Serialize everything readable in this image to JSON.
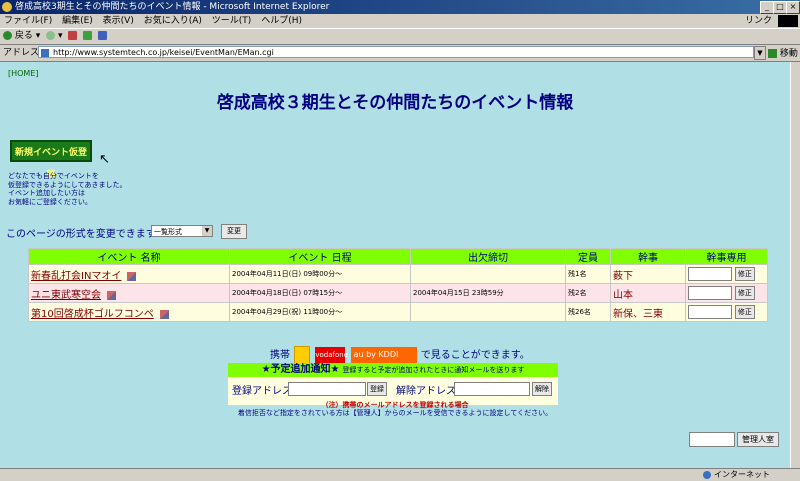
{
  "window": {
    "title": "啓成高校3期生とその仲間たちのイベント情報 - Microsoft Internet Explorer"
  },
  "menu": {
    "items": [
      "ファイル(F)",
      "編集(E)",
      "表示(V)",
      "お気に入り(A)",
      "ツール(T)",
      "ヘルプ(H)"
    ],
    "links_label": "リンク"
  },
  "toolbar": {
    "back_label": "戻る"
  },
  "address": {
    "label": "アドレス(D)",
    "url": "http://www.systemtech.co.jp/keisei/EventMan/EMan.cgi",
    "go_label": "移動"
  },
  "page": {
    "home_link": "[HOME]",
    "title": "啓成高校３期生とその仲間たちのイベント情報",
    "new_event_button": "新規イベント仮登録",
    "notice_text": "どなたでも自分でイベントを\n仮登録できるようにしてあきました。\nイベント追加したい方は\nお気軽にご登録ください。",
    "format_label": "このページの形式を変更できます",
    "format_selected": "一覧形式",
    "change_button": "変更"
  },
  "table": {
    "headers": [
      "イベント 名称",
      "イベント 日程",
      "出欠締切",
      "定員",
      "幹事",
      "幹事専用"
    ],
    "rows": [
      {
        "name": "新春乱打会INマオイ",
        "date": "2004年04月11日(日) 09時00分～",
        "deadline": "",
        "capacity": "残1名",
        "organizer": "薮下",
        "edit": "修正"
      },
      {
        "name": "ユニ東武寒空会",
        "date": "2004年04月18日(日) 07時15分～",
        "deadline": "2004年04月15日 23時59分",
        "capacity": "残2名",
        "organizer": "山本",
        "edit": "修正"
      },
      {
        "name": "第10回啓成杯ゴルフコンペ",
        "date": "2004年04月29日(祝) 11時00分～",
        "deadline": "",
        "capacity": "残26名",
        "organizer": "新保、三東",
        "edit": "修正"
      }
    ]
  },
  "mobile": {
    "prefix": "携帯",
    "suffix": "で見ることができます。",
    "carrier2": "vodafone",
    "carrier3": "au by KDDI"
  },
  "notify": {
    "title": "★予定追加通知★",
    "subtitle": "登録すると予定が追加されたときに通知メールを送ります",
    "register_label": "登録アドレス:",
    "register_button": "登録",
    "unregister_label": "解除アドレス:",
    "unregister_button": "解除",
    "note_warning": "（注）携帯のメールアドレスを登録される場合",
    "note_detail": "着信拒否など指定をされている方は【管理人】からのメールを受信できるように設定してください。"
  },
  "admin": {
    "button": "管理人室"
  },
  "status": {
    "zone": "インターネット"
  }
}
